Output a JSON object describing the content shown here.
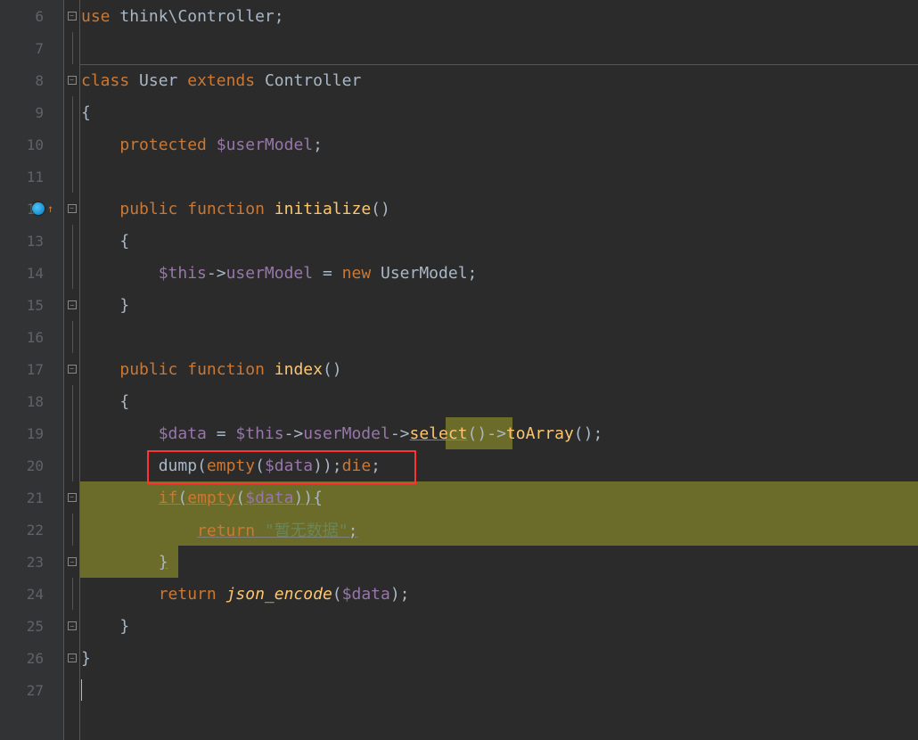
{
  "lines": {
    "start": 6,
    "end": 27
  },
  "code": {
    "l6": {
      "use": "use",
      "ns": "think",
      "bs": "\\",
      "cls": "Controller",
      "semi": ";"
    },
    "l8": {
      "class": "class",
      "name": "User",
      "extends": "extends",
      "parent": "Controller"
    },
    "l9": {
      "brace": "{"
    },
    "l10": {
      "protected": "protected",
      "var": "$userModel",
      "semi": ";"
    },
    "l12": {
      "public": "public",
      "function": "function",
      "name": "initialize",
      "paren": "()"
    },
    "l13": {
      "brace": "{"
    },
    "l14": {
      "this": "$this",
      "arrow": "->",
      "prop": "userModel",
      "eq": " = ",
      "new": "new",
      "cls": "UserModel",
      "semi": ";"
    },
    "l15": {
      "brace": "}"
    },
    "l17": {
      "public": "public",
      "function": "function",
      "name": "index",
      "paren": "()"
    },
    "l18": {
      "brace": "{"
    },
    "l19": {
      "var": "$data",
      "eq": " = ",
      "this": "$this",
      "arrow1": "->",
      "prop": "userModel",
      "arrow2": "->",
      "select": "select",
      "p1": "()",
      "arrow3": "->",
      "toArray": "toArray",
      "p2": "();"
    },
    "l20": {
      "dump": "dump",
      "p1": "(",
      "empty": "empty",
      "p2": "(",
      "var": "$data",
      "p3": "));",
      "die": "die",
      "semi": ";"
    },
    "l21": {
      "if": "if",
      "p1": "(",
      "empty": "empty",
      "p2": "(",
      "var": "$data",
      "p3": ")){"
    },
    "l22": {
      "return": "return",
      "str": "\"暂无数据\"",
      "semi": ";"
    },
    "l23": {
      "brace": "}"
    },
    "l24": {
      "return": "return",
      "fn": "json_encode",
      "p1": "(",
      "var": "$data",
      "p2": ");"
    },
    "l25": {
      "brace": "}"
    },
    "l26": {
      "brace": "}"
    }
  }
}
